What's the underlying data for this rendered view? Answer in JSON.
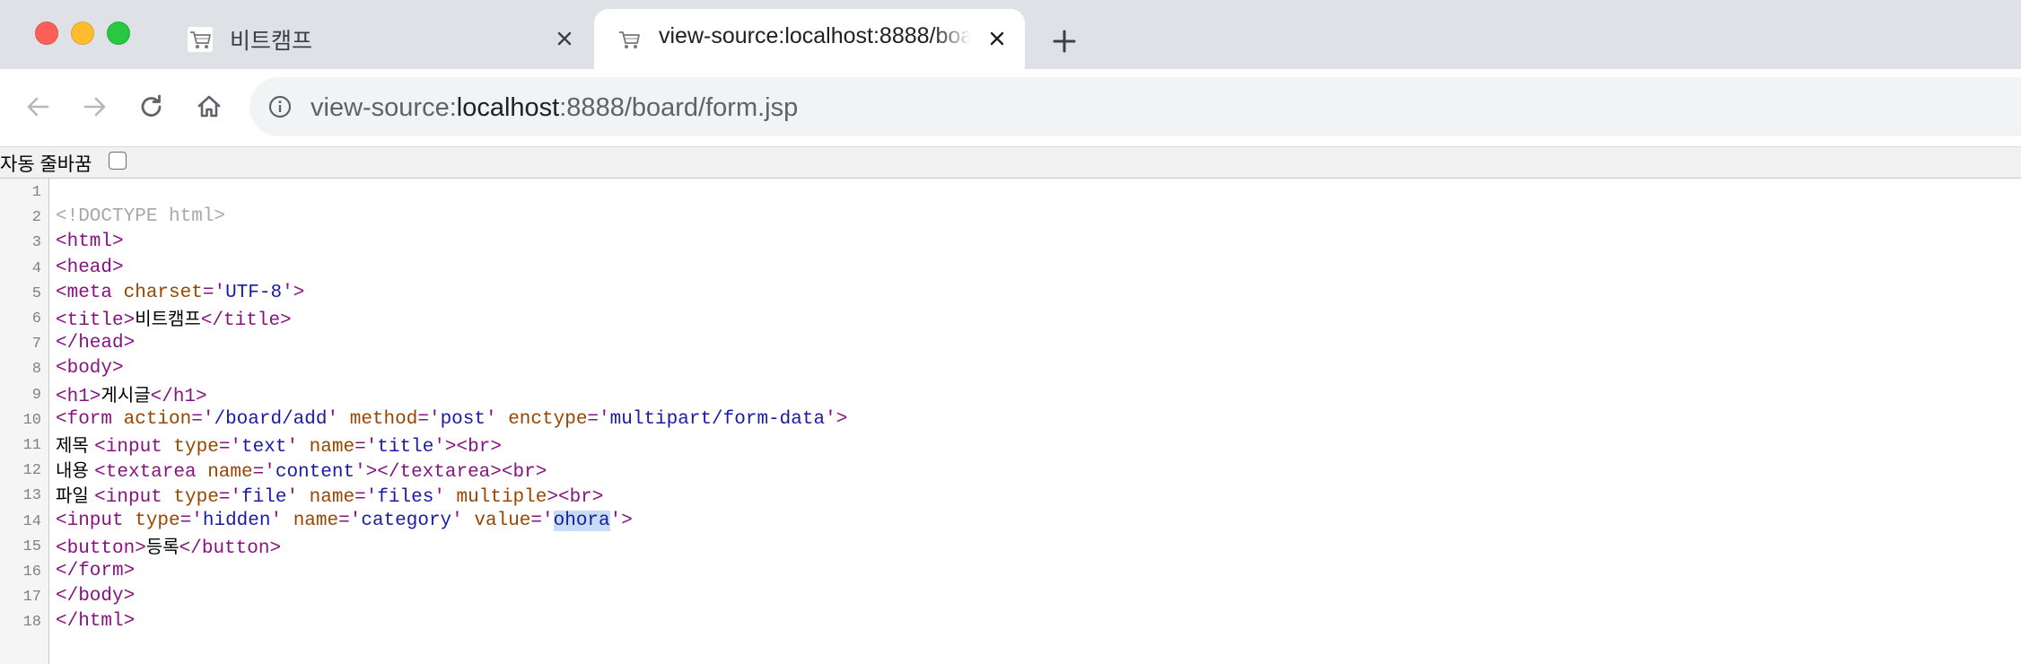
{
  "window": {
    "tabs": [
      {
        "title": "비트캠프",
        "icon": "cart-icon",
        "active": false
      },
      {
        "title": "view-source:localhost:8888/board/form.jsp",
        "icon": "cart-icon",
        "active": true
      }
    ]
  },
  "toolbar": {
    "url_scheme": "view-source:",
    "url_host": "localhost",
    "url_rest": ":8888/board/form.jsp"
  },
  "linewrap": {
    "label": "자동 줄바꿈",
    "checked": false
  },
  "source": {
    "line_numbers": [
      "1",
      "2",
      "3",
      "4",
      "5",
      "6",
      "7",
      "8",
      "9",
      "10",
      "11",
      "12",
      "13",
      "14",
      "15",
      "16",
      "17",
      "18"
    ],
    "lines": [
      [],
      [
        {
          "t": "doctype",
          "v": "<!DOCTYPE html>"
        }
      ],
      [
        {
          "t": "tag",
          "v": "<html>"
        }
      ],
      [
        {
          "t": "tag",
          "v": "<head>"
        }
      ],
      [
        {
          "t": "tag",
          "v": "<meta "
        },
        {
          "t": "attr",
          "v": "charset"
        },
        {
          "t": "tag",
          "v": "='"
        },
        {
          "t": "val",
          "v": "UTF-8"
        },
        {
          "t": "tag",
          "v": "'>"
        }
      ],
      [
        {
          "t": "tag",
          "v": "<title>"
        },
        {
          "t": "txt",
          "v": "비트캠프"
        },
        {
          "t": "tag",
          "v": "</title>"
        }
      ],
      [
        {
          "t": "tag",
          "v": "</head>"
        }
      ],
      [
        {
          "t": "tag",
          "v": "<body>"
        }
      ],
      [
        {
          "t": "tag",
          "v": "<h1>"
        },
        {
          "t": "txt",
          "v": "게시글"
        },
        {
          "t": "tag",
          "v": "</h1>"
        }
      ],
      [
        {
          "t": "tag",
          "v": "<form "
        },
        {
          "t": "attr",
          "v": "action"
        },
        {
          "t": "tag",
          "v": "='"
        },
        {
          "t": "val",
          "v": "/board/add"
        },
        {
          "t": "tag",
          "v": "' "
        },
        {
          "t": "attr",
          "v": "method"
        },
        {
          "t": "tag",
          "v": "='"
        },
        {
          "t": "val",
          "v": "post"
        },
        {
          "t": "tag",
          "v": "' "
        },
        {
          "t": "attr",
          "v": "enctype"
        },
        {
          "t": "tag",
          "v": "='"
        },
        {
          "t": "val",
          "v": "multipart/form-data"
        },
        {
          "t": "tag",
          "v": "'>"
        }
      ],
      [
        {
          "t": "txt",
          "v": "제목 "
        },
        {
          "t": "tag",
          "v": "<input "
        },
        {
          "t": "attr",
          "v": "type"
        },
        {
          "t": "tag",
          "v": "='"
        },
        {
          "t": "val",
          "v": "text"
        },
        {
          "t": "tag",
          "v": "' "
        },
        {
          "t": "attr",
          "v": "name"
        },
        {
          "t": "tag",
          "v": "='"
        },
        {
          "t": "val",
          "v": "title"
        },
        {
          "t": "tag",
          "v": "'><br>"
        }
      ],
      [
        {
          "t": "txt",
          "v": "내용 "
        },
        {
          "t": "tag",
          "v": "<textarea "
        },
        {
          "t": "attr",
          "v": "name"
        },
        {
          "t": "tag",
          "v": "='"
        },
        {
          "t": "val",
          "v": "content"
        },
        {
          "t": "tag",
          "v": "'></textarea><br>"
        }
      ],
      [
        {
          "t": "txt",
          "v": "파일 "
        },
        {
          "t": "tag",
          "v": "<input "
        },
        {
          "t": "attr",
          "v": "type"
        },
        {
          "t": "tag",
          "v": "='"
        },
        {
          "t": "val",
          "v": "file"
        },
        {
          "t": "tag",
          "v": "' "
        },
        {
          "t": "attr",
          "v": "name"
        },
        {
          "t": "tag",
          "v": "='"
        },
        {
          "t": "val",
          "v": "files"
        },
        {
          "t": "tag",
          "v": "' "
        },
        {
          "t": "attr",
          "v": "multiple"
        },
        {
          "t": "tag",
          "v": "><br>"
        }
      ],
      [
        {
          "t": "tag",
          "v": "<input "
        },
        {
          "t": "attr",
          "v": "type"
        },
        {
          "t": "tag",
          "v": "='"
        },
        {
          "t": "val",
          "v": "hidden"
        },
        {
          "t": "tag",
          "v": "' "
        },
        {
          "t": "attr",
          "v": "name"
        },
        {
          "t": "tag",
          "v": "='"
        },
        {
          "t": "val",
          "v": "category"
        },
        {
          "t": "tag",
          "v": "' "
        },
        {
          "t": "attr",
          "v": "value"
        },
        {
          "t": "tag",
          "v": "='"
        },
        {
          "t": "val sel",
          "v": "ohora"
        },
        {
          "t": "tag",
          "v": "'>"
        }
      ],
      [
        {
          "t": "tag",
          "v": "<button>"
        },
        {
          "t": "txt",
          "v": "등록"
        },
        {
          "t": "tag",
          "v": "</button>"
        }
      ],
      [
        {
          "t": "tag",
          "v": "</form>"
        }
      ],
      [
        {
          "t": "tag",
          "v": "</body>"
        }
      ],
      [
        {
          "t": "tag",
          "v": "</html>"
        }
      ]
    ]
  },
  "colors": {
    "tabstrip_bg": "#dee1e6",
    "tag": "#881280",
    "attribute": "#994500",
    "value": "#1a1aa6",
    "doctype": "#a8a8a8",
    "selection": "#c8dcf5"
  }
}
